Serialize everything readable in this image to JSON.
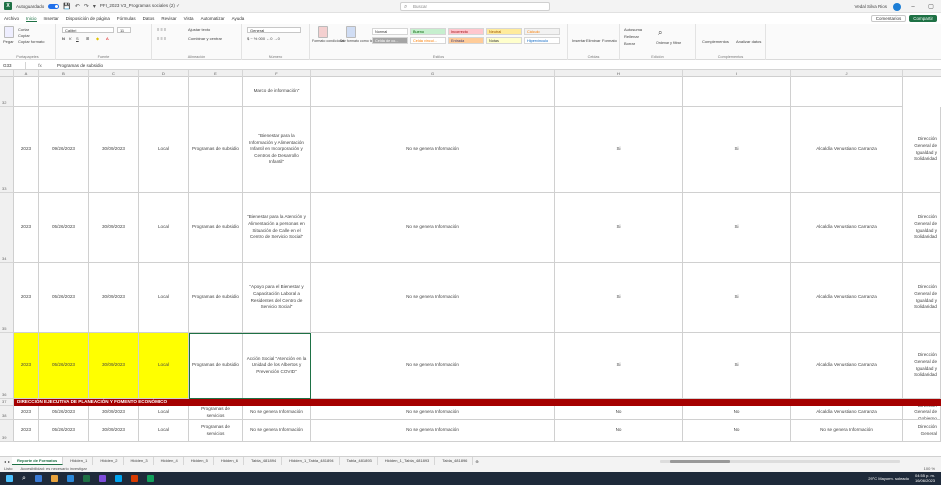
{
  "titlebar": {
    "logo": "X",
    "autosave": "Autoguardado",
    "filename": "PFI_2023 V3_Programas sociales (2) ✓",
    "search": "Buscar",
    "user": "Vedal Silva Rios",
    "icons": [
      "save-icon",
      "undo-icon",
      "redo-icon",
      "customize-icon"
    ]
  },
  "menu": {
    "items": [
      "Archivo",
      "Inicio",
      "Insertar",
      "Disposición de página",
      "Fórmulas",
      "Datos",
      "Revisar",
      "Vista",
      "Automatizar",
      "Ayuda"
    ],
    "active_index": 1,
    "comments": "Comentarios",
    "share": "Compartir"
  },
  "ribbon": {
    "groups": [
      "Portapapeles",
      "Fuente",
      "Alineación",
      "Número",
      "Estilos",
      "Celdas",
      "Edición",
      "Complementos"
    ],
    "paste": "Pegar",
    "cut": "Cortar",
    "copy": "Copiar",
    "format_painter": "Copiar formato",
    "font_name": "Calibri",
    "font_size": "11",
    "wrap": "Ajustar texto",
    "merge": "Combinar y centrar",
    "number_format": "General",
    "conditional": "Formato condicional",
    "table_format": "Dar formato como tabla",
    "styles": [
      {
        "label": "Normal",
        "bg": "#ffffff",
        "fg": "#333333"
      },
      {
        "label": "Bueno",
        "bg": "#c6efce",
        "fg": "#006100"
      },
      {
        "label": "Incorrecto",
        "bg": "#ffc7ce",
        "fg": "#9c0006"
      },
      {
        "label": "Neutral",
        "bg": "#ffeb9c",
        "fg": "#9c5700"
      },
      {
        "label": "Cálculo",
        "bg": "#f2f2f2",
        "fg": "#fa7d00"
      },
      {
        "label": "Celda de co...",
        "bg": "#a5a5a5",
        "fg": "#ffffff"
      },
      {
        "label": "Celda vincul...",
        "bg": "#ffffff",
        "fg": "#fa7d00"
      },
      {
        "label": "Entrada",
        "bg": "#ffcc99",
        "fg": "#3f3f76"
      },
      {
        "label": "Notas",
        "bg": "#ffffcc",
        "fg": "#333333"
      },
      {
        "label": "Hipervínculo",
        "bg": "#ffffff",
        "fg": "#0563c1"
      }
    ],
    "insert": "Insertar",
    "delete": "Eliminar",
    "format": "Formato",
    "autosum": "Autosuma",
    "fill": "Rellenar",
    "clear": "Borrar",
    "sort": "Ordenar y filtrar",
    "find": "Buscar y seleccionar",
    "addins": "Complementos",
    "analyze": "Analizar datos"
  },
  "formula": {
    "namebox": "G33",
    "fx": "fx",
    "content": "Programas de subsidio"
  },
  "columns": [
    "A",
    "B",
    "C",
    "D",
    "E",
    "F",
    "G",
    "H",
    "I",
    "J"
  ],
  "rows": [
    {
      "num": "32",
      "cells": [
        "",
        "",
        "",
        "",
        "",
        "Marco de información\"",
        "",
        "",
        "",
        ""
      ],
      "yellow": false
    },
    {
      "num": "33",
      "cells": [
        "2023",
        "09/26/2023",
        "30/09/2023",
        "Local",
        "Programas de subsidio",
        "\"Bienestar para la Información y Alimentación Infantil en Incorporación y Centros de Desarrollo Infantil\"",
        "No se genera Información",
        "Si",
        "Si",
        "Alcaldía Venustiano Carranza",
        "Dirección General de Igualdad y Solidaridad"
      ],
      "yellow": false
    },
    {
      "num": "34",
      "cells": [
        "2023",
        "05/26/2023",
        "30/09/2023",
        "Local",
        "Programas de subsidio",
        "\"Bienestar para la Atención y Alimentación a personas en Situación de Calle en el Centro de Servicio Social\"",
        "No se genera Información",
        "Si",
        "Si",
        "Alcaldía Venustiano Carranza",
        "Dirección General de Igualdad y Solidaridad"
      ],
      "yellow": false
    },
    {
      "num": "35",
      "cells": [
        "2023",
        "05/26/2023",
        "30/09/2023",
        "Local",
        "Programas de subsidio",
        "\"Apoyo para el Bienestar y Capacitación Laboral a Residentes del Centro de Servicio Social\"",
        "No se genera Información",
        "Si",
        "Si",
        "Alcaldía Venustiano Carranza",
        "Dirección General de Igualdad y Solidaridad"
      ],
      "yellow": false
    },
    {
      "num": "36",
      "cells": [
        "2023",
        "05/26/2023",
        "30/09/2023",
        "Local",
        "Programas de subsidio",
        "Acción Social \"Atención en la Unidad de los Albertos y Prevención COVID\"",
        "No se genera Información",
        "Si",
        "Si",
        "Alcaldía Venustiano Carranza",
        "Dirección General de Igualdad y Solidaridad"
      ],
      "yellow": true
    },
    {
      "num": "38",
      "cells": [
        "2023",
        "05/26/2023",
        "30/09/2023",
        "Local",
        "Programas de servicios",
        "No se genera Información",
        "No se genera Información",
        "No",
        "No",
        "Alcaldía Venustiano Carranza",
        "Dirección General de Gobierno"
      ],
      "yellow": false
    },
    {
      "num": "39",
      "cells": [
        "2023",
        "05/26/2023",
        "30/09/2023",
        "Local",
        "Programas de servicios",
        "No se genera Información",
        "No se genera Información",
        "No",
        "No",
        "No se genera Información",
        "Dirección General"
      ],
      "yellow": false
    }
  ],
  "section_row": {
    "num": "37",
    "text": "DIRECCIÓN EJECUTIVA DE PLANEACIÓN Y FOMENTO ECONÓMICO"
  },
  "sheet_tabs": [
    "Reporte de Formatos",
    "Hidden_1",
    "Hidden_2",
    "Hidden_3",
    "Hidden_4",
    "Hidden_5",
    "Hidden_6",
    "Tabla_481894",
    "Hidden_1_Tabla_481894",
    "Tabla_481893",
    "Hidden_1_Tabla_481893",
    "Tabla_481896"
  ],
  "active_tab": 0,
  "status": {
    "ready": "Listo",
    "accessibility": "Accesibilidad: es necesario investigar"
  },
  "zoom": "100 %",
  "taskbar": {
    "weather": "29°C Mayorm. soleado",
    "time": "04:55 p. m.",
    "date": "16/06/2023",
    "apps": [
      "#3a7bd5",
      "#e8a33d",
      "#2b88d8",
      "#1e7145",
      "#7d4cdb",
      "#00a4ef",
      "#d83b01",
      "#12a05c"
    ]
  }
}
